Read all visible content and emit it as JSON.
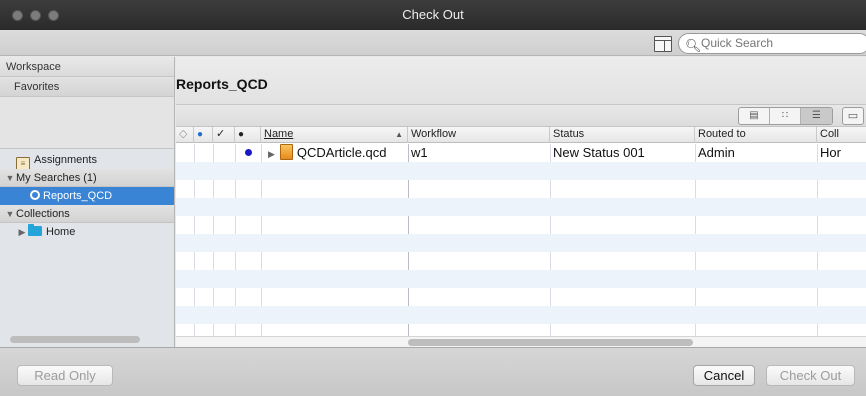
{
  "window": {
    "title": "Check Out"
  },
  "toolbar": {
    "search_placeholder": "Quick Search"
  },
  "sidebar": {
    "workspace_label": "Workspace",
    "favorites_label": "Favorites",
    "assignments_label": "Assignments",
    "my_searches_label": "My Searches (1)",
    "saved_search_label": "Reports_QCD",
    "collections_label": "Collections",
    "home_label": "Home"
  },
  "main": {
    "title": "Reports_QCD",
    "columns": {
      "name": "Name",
      "workflow": "Workflow",
      "status": "Status",
      "routed_to": "Routed to",
      "collection": "Coll"
    },
    "status_glyphs": {
      "col1": "◇",
      "col2": "●",
      "col3": "✓",
      "col4": "●"
    },
    "rows": [
      {
        "name": "QCDArticle.qcd",
        "workflow": "w1",
        "status": "New Status 001",
        "routed_to": "Admin",
        "collection": "Hor"
      }
    ]
  },
  "colors": {
    "selection": "#3a84d6",
    "folder": "#25a4d9",
    "status_dot": "#1919c8"
  },
  "buttons": {
    "read_only": "Read Only",
    "cancel": "Cancel",
    "check_out": "Check Out"
  }
}
